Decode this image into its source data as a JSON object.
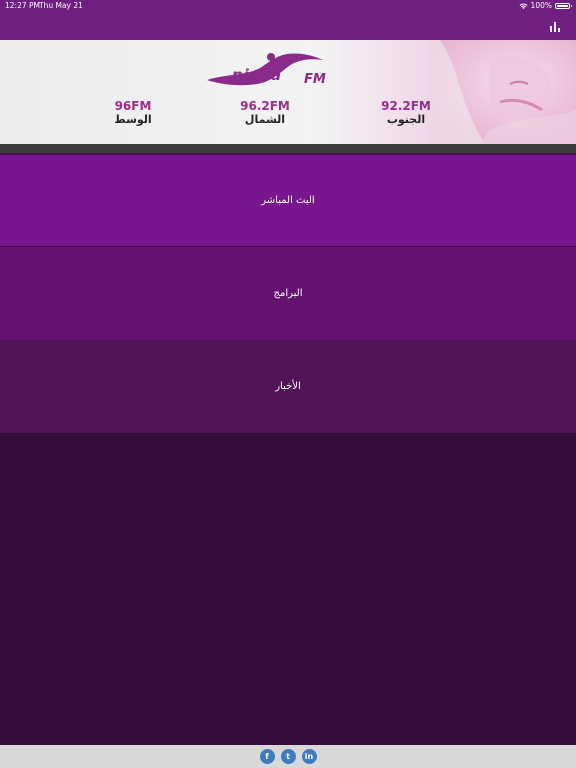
{
  "status_bar": {
    "time": "12:27 PM",
    "date": "Thu May 21",
    "battery": "100%"
  },
  "banner": {
    "logo_main": "nisaa",
    "logo_suffix": "FM",
    "stations": [
      {
        "frequency": "96FM",
        "region": "الوسط"
      },
      {
        "frequency": "96.2FM",
        "region": "الشمال"
      },
      {
        "frequency": "92.2FM",
        "region": "الجنوب"
      }
    ]
  },
  "menu": {
    "items": [
      {
        "label": "البث المباشر"
      },
      {
        "label": "البرامج"
      },
      {
        "label": "الأخبار"
      }
    ]
  },
  "footer": {
    "social": [
      {
        "icon": "facebook-icon",
        "glyph": "f"
      },
      {
        "icon": "twitter-icon",
        "glyph": "t"
      },
      {
        "icon": "linkedin-icon",
        "glyph": "in"
      }
    ]
  },
  "colors": {
    "header": "#6e1f80",
    "menu_1": "#7a1590",
    "menu_2": "#641272",
    "menu_3": "#521458",
    "background": "#350c3c",
    "accent_text": "#9a2d8e"
  }
}
